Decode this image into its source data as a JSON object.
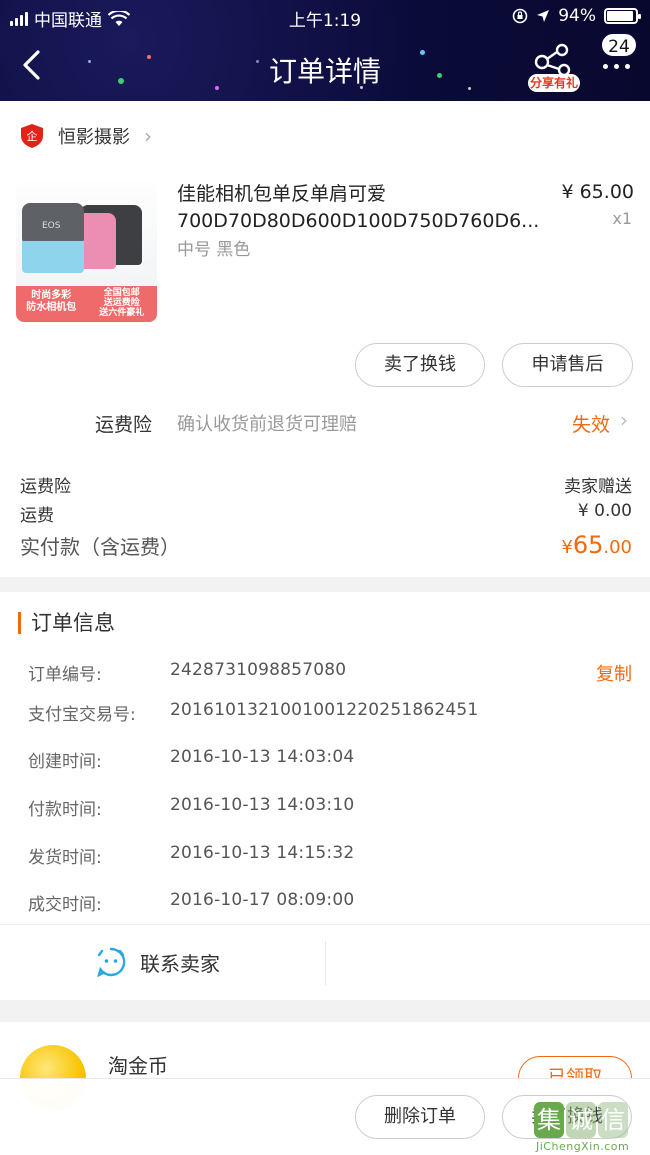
{
  "status_bar": {
    "carrier": "中国联通",
    "time": "上午1:19",
    "battery": "94%"
  },
  "header": {
    "title": "订单详情",
    "share_label": "分享有礼",
    "badge_count": "24"
  },
  "shop": {
    "name": "恒影摄影"
  },
  "product": {
    "name_line1": "佳能相机包单反单肩可爱",
    "name_line2": "700D70D80D600D100D750D760D6...",
    "spec": "中号 黑色",
    "price": "¥ 65.00",
    "qty": "x1",
    "thumb_left_text": "时尚多彩\n防水相机包",
    "thumb_right_text": "全国包邮\n送运费险\n送六件豪礼",
    "bag_label": "EOS"
  },
  "item_actions": {
    "sell": "卖了换钱",
    "after_sale": "申请售后"
  },
  "insurance": {
    "label": "运费险",
    "desc": "确认收货前退货可理赔",
    "status": "失效"
  },
  "fees": {
    "insurance_label": "运费险",
    "insurance_value": "卖家赠送",
    "shipping_label": "运费",
    "shipping_value": "¥ 0.00",
    "total_label": "实付款（含运费）",
    "total_currency": "¥",
    "total_int": "65",
    "total_dec": ".00"
  },
  "order_info": {
    "title": "订单信息",
    "rows": [
      {
        "label": "订单编号:",
        "value": "2428731098857080",
        "action": "复制"
      },
      {
        "label": "支付宝交易号:",
        "value": "2016101321001001220251862451"
      },
      {
        "label": "创建时间:",
        "value": "2016-10-13 14:03:04"
      },
      {
        "label": "付款时间:",
        "value": "2016-10-13 14:03:10"
      },
      {
        "label": "发货时间:",
        "value": "2016-10-13 14:15:32"
      },
      {
        "label": "成交时间:",
        "value": "2016-10-17 08:09:00"
      }
    ],
    "contact_label": "联系卖家"
  },
  "coins": {
    "title": "淘金币",
    "claimed": "已领取"
  },
  "bottom_bar": {
    "delete": "删除订单",
    "sell": "卖了换钱"
  },
  "watermark": {
    "chars": [
      "集",
      "诚",
      "信"
    ],
    "domain": "JiChengXin.com"
  },
  "colors": {
    "accent": "#f26a10",
    "header_bg": "#0b0b3a",
    "icon_blue": "#2aa7e0"
  }
}
